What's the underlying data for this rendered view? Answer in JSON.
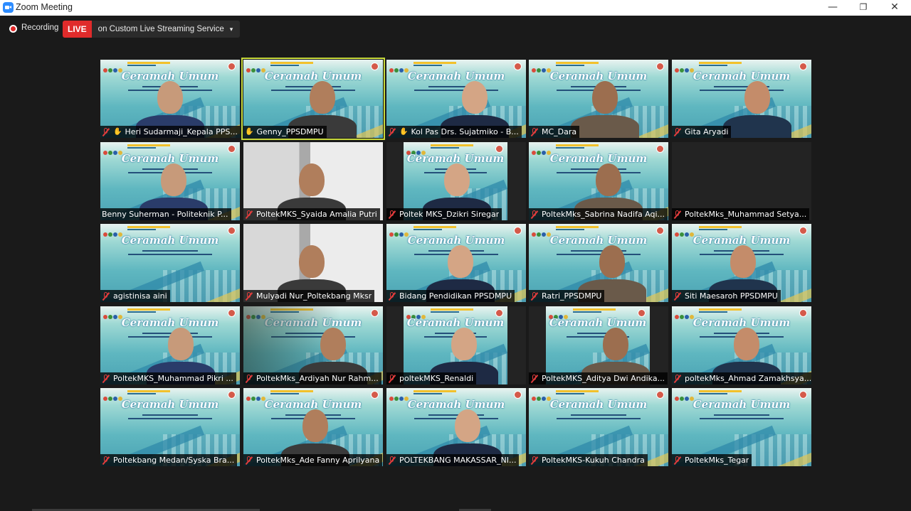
{
  "window": {
    "title": "Zoom Meeting",
    "minimize": "—",
    "restore": "❐",
    "close": "✕"
  },
  "recording": {
    "label": "Recording",
    "live_badge": "LIVE",
    "live_service": "on Custom Live Streaming Service",
    "chevron": "▾"
  },
  "slide": {
    "title": "Ceramah Umum"
  },
  "participants": [
    {
      "name": "Heri Sudarmaji_Kepala PPS...",
      "pinned": true,
      "muted": true,
      "video": "slide-person"
    },
    {
      "name": "Genny_PPSDMPU",
      "pinned": true,
      "muted": false,
      "video": "slide-person",
      "active": true
    },
    {
      "name": "Kol Pas Drs. Sujatmiko - B...",
      "pinned": true,
      "muted": true,
      "video": "slide-person"
    },
    {
      "name": "MC_Dara",
      "pinned": false,
      "muted": true,
      "video": "slide-person"
    },
    {
      "name": "Gita Aryadi",
      "pinned": false,
      "muted": true,
      "video": "slide-person"
    },
    {
      "name": "Benny Suherman - Politeknik P...",
      "pinned": false,
      "muted": false,
      "video": "slide-person"
    },
    {
      "name": "PoltekMKS_Syaida Amalia Putri",
      "pinned": false,
      "muted": true,
      "video": "room"
    },
    {
      "name": "Poltek MKS_Dzikri Siregar",
      "pinned": false,
      "muted": true,
      "video": "slide-narrow"
    },
    {
      "name": "PoltekMks_Sabrina Nadifa Aqi...",
      "pinned": false,
      "muted": true,
      "video": "slide-person"
    },
    {
      "name": "PoltekMks_Muhammad Setya...",
      "pinned": false,
      "muted": true,
      "video": "blank"
    },
    {
      "name": "agistinisa aini",
      "pinned": false,
      "muted": true,
      "video": "slide"
    },
    {
      "name": "Mulyadi Nur_Poltekbang Mksr",
      "pinned": false,
      "muted": true,
      "video": "room"
    },
    {
      "name": "Bidang Pendidikan PPSDMPU",
      "pinned": false,
      "muted": true,
      "video": "slide-person"
    },
    {
      "name": "Ratri_PPSDMPU",
      "pinned": false,
      "muted": true,
      "video": "slide-person"
    },
    {
      "name": "Siti Maesaroh PPSDMPU",
      "pinned": false,
      "muted": true,
      "video": "slide-person"
    },
    {
      "name": "PoltekMKS_Muhammad Pikri ...",
      "pinned": false,
      "muted": true,
      "video": "slide-person"
    },
    {
      "name": "PoltekMks_Ardiyah Nur Rahm...",
      "pinned": false,
      "muted": true,
      "video": "slide-room"
    },
    {
      "name": "poltekMKS_Renaldi",
      "pinned": false,
      "muted": true,
      "video": "slide-narrow"
    },
    {
      "name": "PoltekMKS_Aditya Dwi Andika...",
      "pinned": false,
      "muted": true,
      "video": "slide-narrow"
    },
    {
      "name": "poltekMks_Ahmad Zamakhsya...",
      "pinned": false,
      "muted": true,
      "video": "slide-person"
    },
    {
      "name": "Poltekbang Medan/Syska Bra...",
      "pinned": false,
      "muted": true,
      "video": "slide"
    },
    {
      "name": "PoltekMks_Ade Fanny Aprilyana",
      "pinned": false,
      "muted": true,
      "video": "slide-person"
    },
    {
      "name": "POLTEKBANG MAKASSAR_NI...",
      "pinned": false,
      "muted": true,
      "video": "slide-person"
    },
    {
      "name": "PoltekMKS-Kukuh Chandra",
      "pinned": false,
      "muted": true,
      "video": "slide"
    },
    {
      "name": "PoltekMks_Tegar",
      "pinned": false,
      "muted": true,
      "video": "slide"
    }
  ],
  "colors": {
    "active_speaker_border": "#c6d83a",
    "live_red": "#e02b2b",
    "muted_red": "#e23c3c",
    "background": "#1a1a1a"
  }
}
